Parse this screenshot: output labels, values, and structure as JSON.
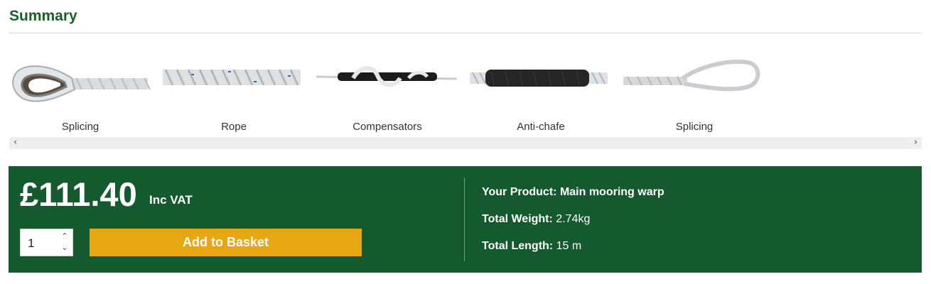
{
  "summary": {
    "title": "Summary"
  },
  "carousel": {
    "items": [
      {
        "label": "Splicing",
        "icon": "eye-splice-thimble-icon"
      },
      {
        "label": "Rope",
        "icon": "rope-icon"
      },
      {
        "label": "Compensators",
        "icon": "rubber-compensator-icon"
      },
      {
        "label": "Anti-chafe",
        "icon": "anti-chafe-sleeve-icon"
      },
      {
        "label": "Splicing",
        "icon": "soft-eye-splice-icon"
      }
    ],
    "scroll_left": "‹",
    "scroll_right": "›"
  },
  "purchase": {
    "price": "£111.40",
    "vat_label": "Inc VAT",
    "quantity": "1",
    "add_button": "Add to Basket"
  },
  "details": {
    "product_label": "Your Product:",
    "product_value": "Main mooring warp",
    "weight_label": "Total Weight:",
    "weight_value": "2.74kg",
    "length_label": "Total Length:",
    "length_value": "15 m"
  },
  "colors": {
    "brand_green": "#145a2e",
    "title_green": "#1b5e2c",
    "button_gold": "#e7a714"
  }
}
